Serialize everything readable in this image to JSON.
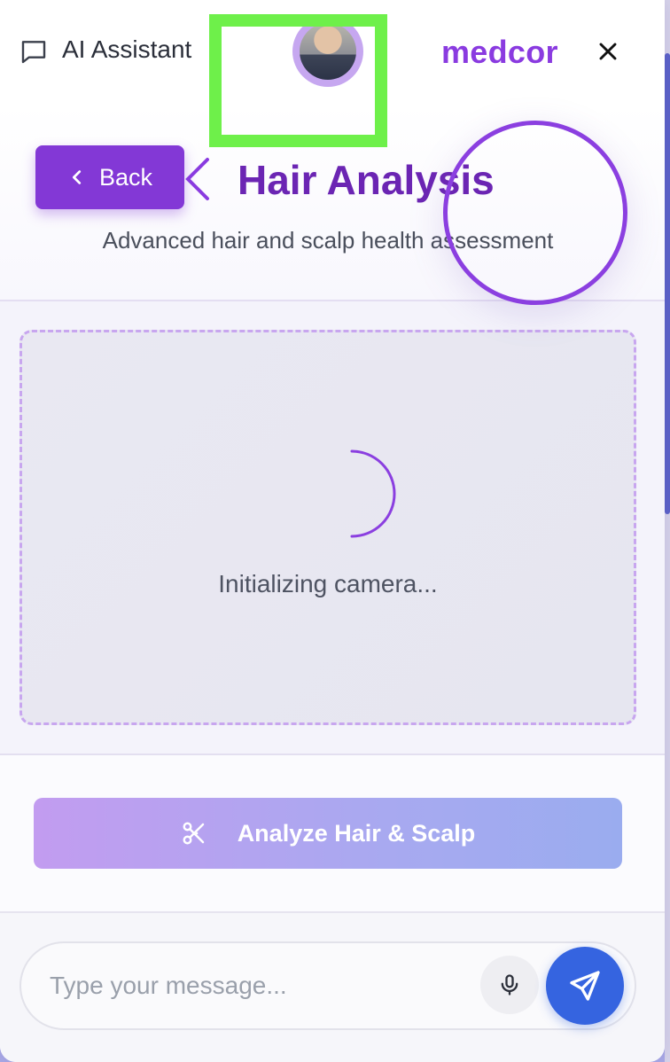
{
  "header": {
    "assistant_label": "AI Assistant",
    "brand": "medcor",
    "icons": {
      "chat": "chat-bubble-icon",
      "close": "close-icon",
      "avatar": "user-avatar"
    }
  },
  "page": {
    "back_label": "Back",
    "title": "Hair Analysis",
    "subtitle": "Advanced hair and scalp health assessment"
  },
  "camera": {
    "status": "Initializing camera...",
    "icon": "loading-spinner-icon"
  },
  "analyze": {
    "label": "Analyze Hair & Scalp",
    "icon": "scissors-icon"
  },
  "composer": {
    "placeholder": "Type your message...",
    "mic_icon": "microphone-icon",
    "send_icon": "send-icon"
  },
  "colors": {
    "accent": "#8338d6",
    "title": "#6b25b3",
    "brand": "#8a3be0",
    "send": "#3564e0",
    "highlight_box": "#6ef04a",
    "focus_ring": "#8b3fe0"
  }
}
